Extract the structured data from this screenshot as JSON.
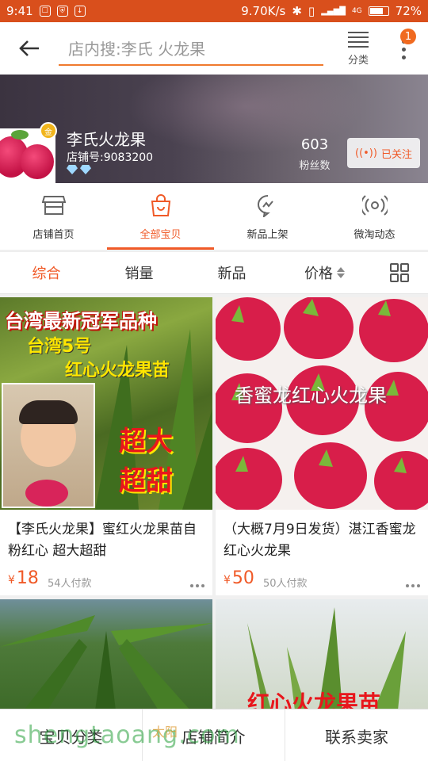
{
  "status_bar": {
    "time": "9:41",
    "network_speed": "9.70K/s",
    "battery": "72%",
    "signal_label": "4G"
  },
  "header": {
    "search_placeholder": "店内搜:李氏 火龙果",
    "category_label": "分类",
    "notification_count": "1"
  },
  "shop": {
    "name": "李氏火龙果",
    "shop_no": "店铺号:9083200",
    "fans_count": "603",
    "fans_label": "粉丝数",
    "follow_label": "已关注",
    "badge_text": "金"
  },
  "shop_nav": [
    {
      "label": "店铺首页",
      "icon": "store-icon",
      "active": false
    },
    {
      "label": "全部宝贝",
      "icon": "shopping-bag-icon",
      "active": true
    },
    {
      "label": "新品上架",
      "icon": "chat-bubble-icon",
      "active": false
    },
    {
      "label": "微淘动态",
      "icon": "broadcast-icon",
      "active": false
    }
  ],
  "sort_bar": [
    {
      "label": "综合",
      "active": true
    },
    {
      "label": "销量",
      "active": false
    },
    {
      "label": "新品",
      "active": false
    },
    {
      "label": "价格",
      "active": false
    }
  ],
  "products": [
    {
      "title": "【李氏火龙果】蜜红火龙果苗自粉红心 超大超甜",
      "price": "18",
      "currency": "¥",
      "sold": "54人付款",
      "image_texts": [
        "台湾最新冠军品种",
        "台湾5号",
        "红心火龙果苗",
        "超大",
        "超甜"
      ]
    },
    {
      "title": "（大概7月9日发货）湛江香蜜龙红心火龙果",
      "price": "50",
      "currency": "¥",
      "sold": "50人付款",
      "image_texts": [
        "香蜜龙红心火龙果"
      ]
    },
    {
      "title": "",
      "price": "",
      "currency": "",
      "sold": "",
      "image_texts": []
    },
    {
      "title": "",
      "price": "",
      "currency": "",
      "sold": "",
      "image_texts": [
        "红心火龙果苗"
      ]
    }
  ],
  "bottom_bar": [
    {
      "label": "宝贝分类"
    },
    {
      "label": "店铺简介"
    },
    {
      "label": "联系卖家"
    }
  ],
  "watermark": {
    "main": "shengtaoang.com",
    "logo": "太阳"
  },
  "colors": {
    "accent": "#f05a28",
    "status_bar": "#d94f1c",
    "watermark": "#28a03c"
  }
}
